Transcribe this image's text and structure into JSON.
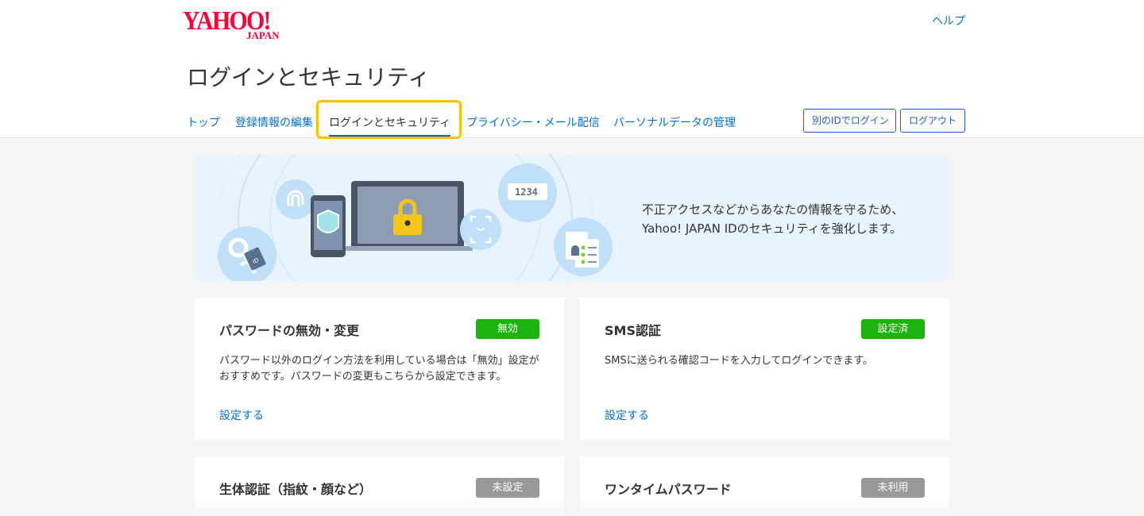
{
  "header": {
    "logo_main": "YAHOO!",
    "logo_sub": "JAPAN",
    "help": "ヘルプ",
    "page_title": "ログインとセキュリティ"
  },
  "tabs": [
    {
      "label": "トップ"
    },
    {
      "label": "登録情報の編集"
    },
    {
      "label": "ログインとセキュリティ",
      "active": true
    },
    {
      "label": "プライバシー・メール配信"
    },
    {
      "label": "パーソナルデータの管理"
    }
  ],
  "buttons": {
    "alt_login": "別のIDでログイン",
    "logout": "ログアウト"
  },
  "hero": {
    "line1": "不正アクセスなどからあなたの情報を守るため、",
    "line2": "Yahoo! JAPAN IDのセキュリティを強化します。",
    "code": "1234",
    "id_tag": "ID"
  },
  "cards": [
    {
      "title": "パスワードの無効・変更",
      "badge": "無効",
      "badge_color": "#1db30d",
      "desc1": "パスワード以外のログイン方法を利用している場合は「無効」設定が",
      "desc2": "おすすめです。パスワードの変更もこちらから設定できます。",
      "link": "設定する"
    },
    {
      "title": "SMS認証",
      "badge": "設定済",
      "badge_color": "#1db30d",
      "desc1": "SMSに送られる確認コードを入力してログインできます。",
      "desc2": "",
      "link": "設定する"
    },
    {
      "title": "生体認証（指紋・顔など）",
      "badge": "未設定",
      "badge_color": "#999999"
    },
    {
      "title": "ワンタイムパスワード",
      "badge": "未利用",
      "badge_color": "#999999"
    }
  ],
  "colors": {
    "brand_red": "#ff0033",
    "link_blue": "#0070d9",
    "focus_ring": "#ffbf00",
    "active_underline": "#1e5bdc"
  }
}
